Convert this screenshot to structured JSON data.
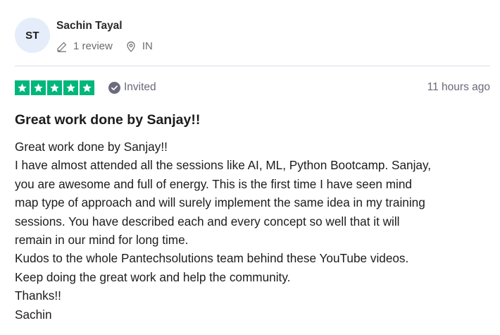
{
  "reviewer": {
    "initials": "ST",
    "name": "Sachin Tayal",
    "review_count": "1 review",
    "country": "IN",
    "avatar_bg": "#e5edfa"
  },
  "rating": {
    "stars": 5,
    "max_stars": 5,
    "star_color": "#00b67a",
    "badge": "Invited",
    "time": "11 hours ago"
  },
  "review": {
    "title": "Great work done by Sanjay!!",
    "lines": [
      "Great work done by Sanjay!!",
      "I have almost attended all the sessions like AI, ML, Python Bootcamp. Sanjay,",
      "you are awesome and full of energy. This is the first time I have seen mind",
      "map type of approach and will surely implement the same idea in my training",
      "sessions. You have described each and every concept so well that it will",
      "remain in our mind for long time.",
      "Kudos to the whole Pantechsolutions team behind these YouTube videos.",
      "Keep doing the great work and help the community.",
      "Thanks!!",
      "Sachin"
    ]
  }
}
